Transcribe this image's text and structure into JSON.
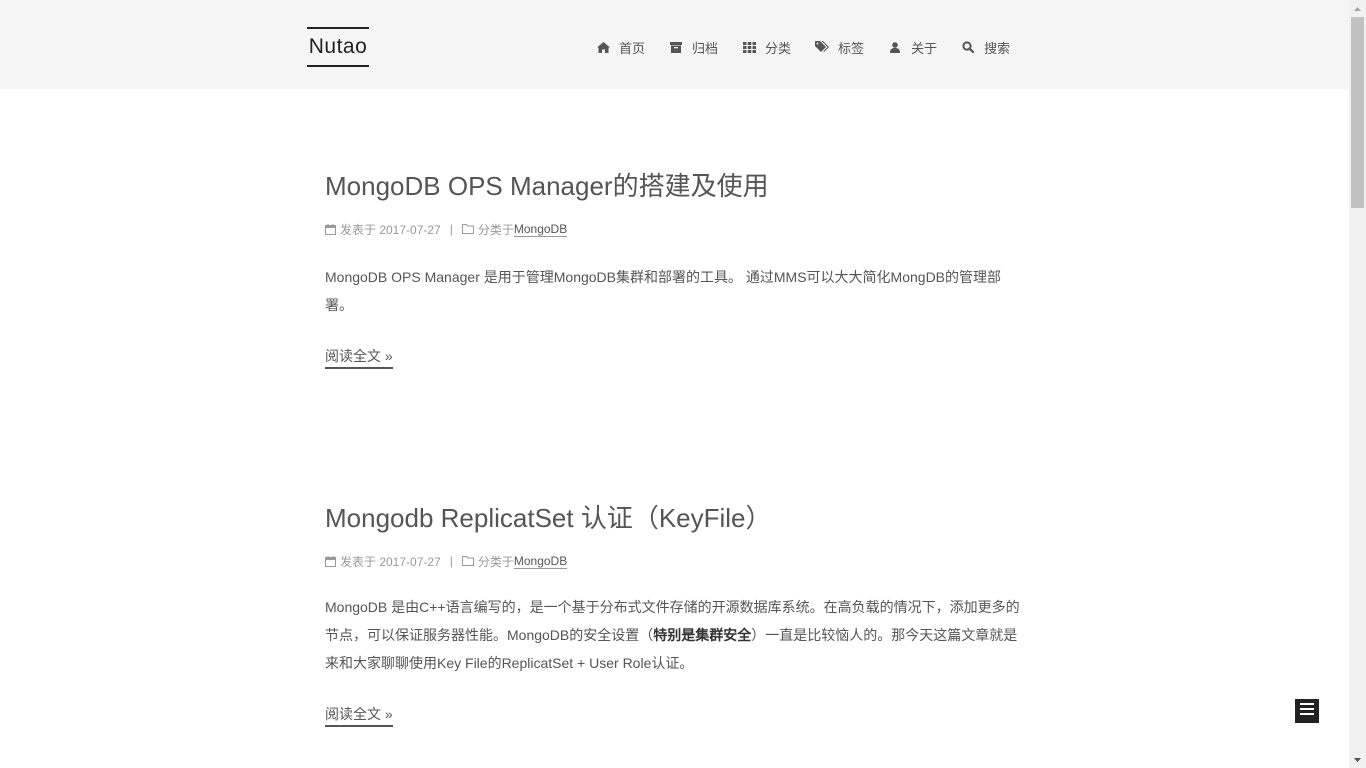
{
  "site": {
    "brand": "Nutao"
  },
  "nav": [
    {
      "label": "首页",
      "icon": "home-icon"
    },
    {
      "label": "归档",
      "icon": "archive-icon"
    },
    {
      "label": "分类",
      "icon": "grid-icon"
    },
    {
      "label": "标签",
      "icon": "tags-icon"
    },
    {
      "label": "关于",
      "icon": "user-icon"
    },
    {
      "label": "搜索",
      "icon": "search-icon"
    }
  ],
  "posts": [
    {
      "title": "MongoDB OPS Manager的搭建及使用",
      "meta_posted": "发表于 2017-07-27",
      "meta_sep": "|",
      "meta_category_prefix": "分类于",
      "meta_category": "MongoDB",
      "excerpt": "MongoDB OPS Manager 是用于管理MongoDB集群和部署的工具。 通过MMS可以大大简化MongDB的管理部署。",
      "read_more": "阅读全文 »"
    },
    {
      "title": "Mongodb ReplicatSet 认证（KeyFile）",
      "meta_posted": "发表于 2017-07-27",
      "meta_sep": "|",
      "meta_category_prefix": "分类于",
      "meta_category": "MongoDB",
      "excerpt_part1": "MongoDB 是由C++语言编写的，是一个基于分布式文件存储的开源数据库系统。在高负载的情况下，添加更多的节点，可以保证服务器性能。MongoDB的安全设置（",
      "excerpt_bold": "特别是集群安全",
      "excerpt_part2": "）一直是比较恼人的。那今天这篇文章就是来和大家聊聊使用Key File的ReplicatSet + User Role认证。",
      "read_more": "阅读全文 »"
    }
  ],
  "colors": {
    "header_bg": "#f5f5f5",
    "text": "#555555",
    "meta": "#999999",
    "brand": "#222222"
  }
}
